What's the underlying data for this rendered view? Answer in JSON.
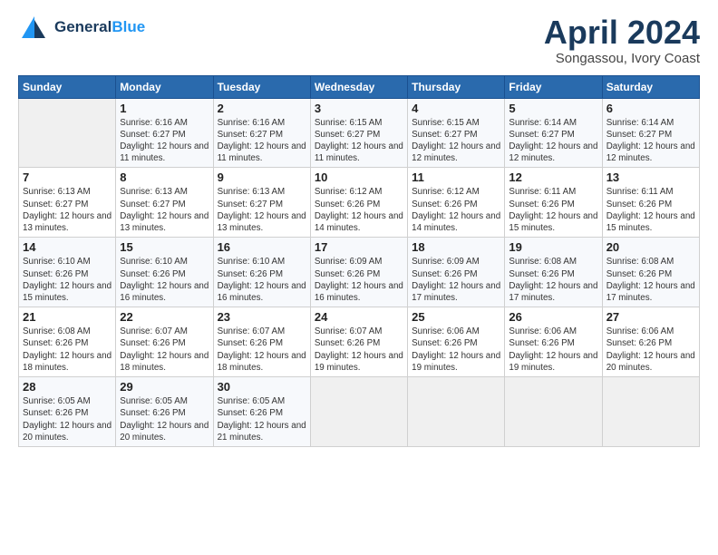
{
  "header": {
    "logo_line1": "General",
    "logo_line2": "Blue",
    "month": "April 2024",
    "location": "Songassou, Ivory Coast"
  },
  "weekdays": [
    "Sunday",
    "Monday",
    "Tuesday",
    "Wednesday",
    "Thursday",
    "Friday",
    "Saturday"
  ],
  "weeks": [
    [
      {
        "day": "",
        "sunrise": "",
        "sunset": "",
        "daylight": ""
      },
      {
        "day": "1",
        "sunrise": "Sunrise: 6:16 AM",
        "sunset": "Sunset: 6:27 PM",
        "daylight": "Daylight: 12 hours and 11 minutes."
      },
      {
        "day": "2",
        "sunrise": "Sunrise: 6:16 AM",
        "sunset": "Sunset: 6:27 PM",
        "daylight": "Daylight: 12 hours and 11 minutes."
      },
      {
        "day": "3",
        "sunrise": "Sunrise: 6:15 AM",
        "sunset": "Sunset: 6:27 PM",
        "daylight": "Daylight: 12 hours and 11 minutes."
      },
      {
        "day": "4",
        "sunrise": "Sunrise: 6:15 AM",
        "sunset": "Sunset: 6:27 PM",
        "daylight": "Daylight: 12 hours and 12 minutes."
      },
      {
        "day": "5",
        "sunrise": "Sunrise: 6:14 AM",
        "sunset": "Sunset: 6:27 PM",
        "daylight": "Daylight: 12 hours and 12 minutes."
      },
      {
        "day": "6",
        "sunrise": "Sunrise: 6:14 AM",
        "sunset": "Sunset: 6:27 PM",
        "daylight": "Daylight: 12 hours and 12 minutes."
      }
    ],
    [
      {
        "day": "7",
        "sunrise": "Sunrise: 6:13 AM",
        "sunset": "Sunset: 6:27 PM",
        "daylight": "Daylight: 12 hours and 13 minutes."
      },
      {
        "day": "8",
        "sunrise": "Sunrise: 6:13 AM",
        "sunset": "Sunset: 6:27 PM",
        "daylight": "Daylight: 12 hours and 13 minutes."
      },
      {
        "day": "9",
        "sunrise": "Sunrise: 6:13 AM",
        "sunset": "Sunset: 6:27 PM",
        "daylight": "Daylight: 12 hours and 13 minutes."
      },
      {
        "day": "10",
        "sunrise": "Sunrise: 6:12 AM",
        "sunset": "Sunset: 6:26 PM",
        "daylight": "Daylight: 12 hours and 14 minutes."
      },
      {
        "day": "11",
        "sunrise": "Sunrise: 6:12 AM",
        "sunset": "Sunset: 6:26 PM",
        "daylight": "Daylight: 12 hours and 14 minutes."
      },
      {
        "day": "12",
        "sunrise": "Sunrise: 6:11 AM",
        "sunset": "Sunset: 6:26 PM",
        "daylight": "Daylight: 12 hours and 15 minutes."
      },
      {
        "day": "13",
        "sunrise": "Sunrise: 6:11 AM",
        "sunset": "Sunset: 6:26 PM",
        "daylight": "Daylight: 12 hours and 15 minutes."
      }
    ],
    [
      {
        "day": "14",
        "sunrise": "Sunrise: 6:10 AM",
        "sunset": "Sunset: 6:26 PM",
        "daylight": "Daylight: 12 hours and 15 minutes."
      },
      {
        "day": "15",
        "sunrise": "Sunrise: 6:10 AM",
        "sunset": "Sunset: 6:26 PM",
        "daylight": "Daylight: 12 hours and 16 minutes."
      },
      {
        "day": "16",
        "sunrise": "Sunrise: 6:10 AM",
        "sunset": "Sunset: 6:26 PM",
        "daylight": "Daylight: 12 hours and 16 minutes."
      },
      {
        "day": "17",
        "sunrise": "Sunrise: 6:09 AM",
        "sunset": "Sunset: 6:26 PM",
        "daylight": "Daylight: 12 hours and 16 minutes."
      },
      {
        "day": "18",
        "sunrise": "Sunrise: 6:09 AM",
        "sunset": "Sunset: 6:26 PM",
        "daylight": "Daylight: 12 hours and 17 minutes."
      },
      {
        "day": "19",
        "sunrise": "Sunrise: 6:08 AM",
        "sunset": "Sunset: 6:26 PM",
        "daylight": "Daylight: 12 hours and 17 minutes."
      },
      {
        "day": "20",
        "sunrise": "Sunrise: 6:08 AM",
        "sunset": "Sunset: 6:26 PM",
        "daylight": "Daylight: 12 hours and 17 minutes."
      }
    ],
    [
      {
        "day": "21",
        "sunrise": "Sunrise: 6:08 AM",
        "sunset": "Sunset: 6:26 PM",
        "daylight": "Daylight: 12 hours and 18 minutes."
      },
      {
        "day": "22",
        "sunrise": "Sunrise: 6:07 AM",
        "sunset": "Sunset: 6:26 PM",
        "daylight": "Daylight: 12 hours and 18 minutes."
      },
      {
        "day": "23",
        "sunrise": "Sunrise: 6:07 AM",
        "sunset": "Sunset: 6:26 PM",
        "daylight": "Daylight: 12 hours and 18 minutes."
      },
      {
        "day": "24",
        "sunrise": "Sunrise: 6:07 AM",
        "sunset": "Sunset: 6:26 PM",
        "daylight": "Daylight: 12 hours and 19 minutes."
      },
      {
        "day": "25",
        "sunrise": "Sunrise: 6:06 AM",
        "sunset": "Sunset: 6:26 PM",
        "daylight": "Daylight: 12 hours and 19 minutes."
      },
      {
        "day": "26",
        "sunrise": "Sunrise: 6:06 AM",
        "sunset": "Sunset: 6:26 PM",
        "daylight": "Daylight: 12 hours and 19 minutes."
      },
      {
        "day": "27",
        "sunrise": "Sunrise: 6:06 AM",
        "sunset": "Sunset: 6:26 PM",
        "daylight": "Daylight: 12 hours and 20 minutes."
      }
    ],
    [
      {
        "day": "28",
        "sunrise": "Sunrise: 6:05 AM",
        "sunset": "Sunset: 6:26 PM",
        "daylight": "Daylight: 12 hours and 20 minutes."
      },
      {
        "day": "29",
        "sunrise": "Sunrise: 6:05 AM",
        "sunset": "Sunset: 6:26 PM",
        "daylight": "Daylight: 12 hours and 20 minutes."
      },
      {
        "day": "30",
        "sunrise": "Sunrise: 6:05 AM",
        "sunset": "Sunset: 6:26 PM",
        "daylight": "Daylight: 12 hours and 21 minutes."
      },
      {
        "day": "",
        "sunrise": "",
        "sunset": "",
        "daylight": ""
      },
      {
        "day": "",
        "sunrise": "",
        "sunset": "",
        "daylight": ""
      },
      {
        "day": "",
        "sunrise": "",
        "sunset": "",
        "daylight": ""
      },
      {
        "day": "",
        "sunrise": "",
        "sunset": "",
        "daylight": ""
      }
    ]
  ]
}
